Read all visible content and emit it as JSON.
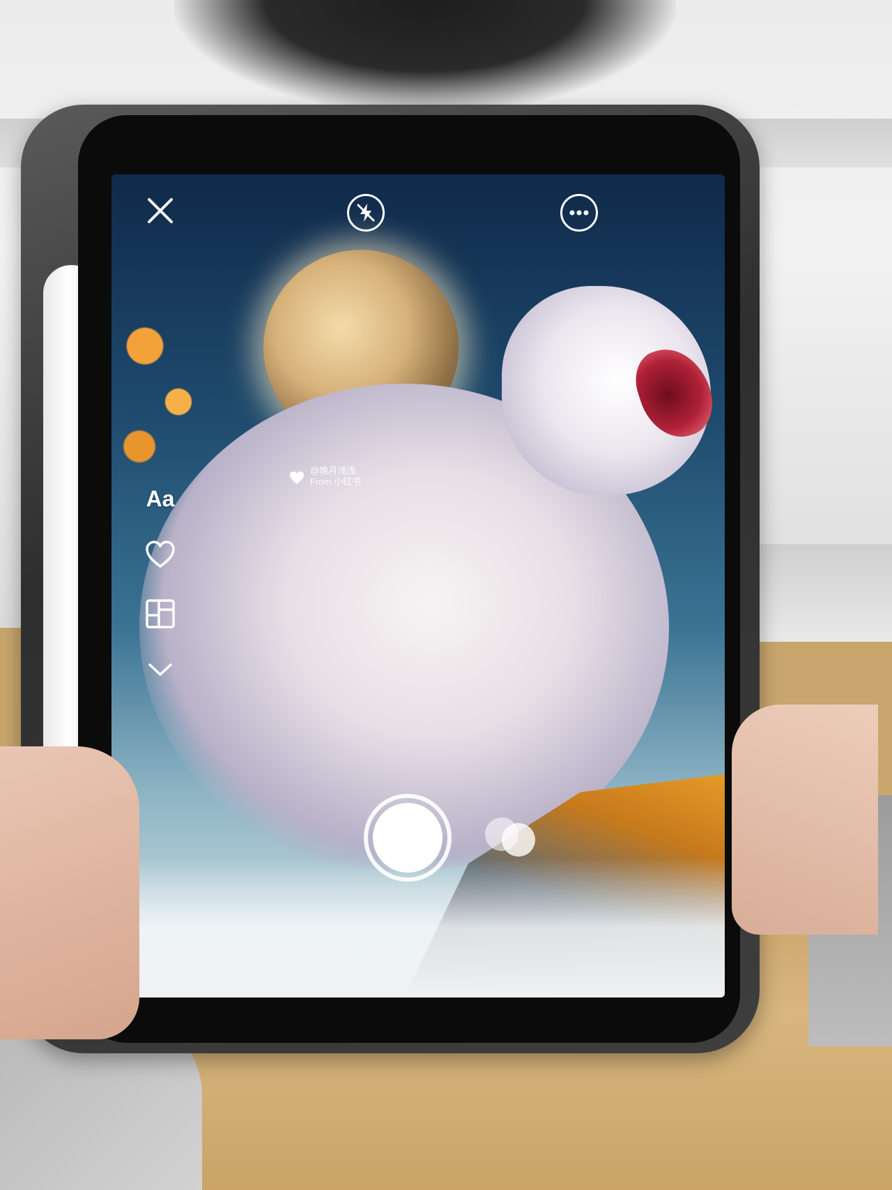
{
  "camera": {
    "side_tools": {
      "text_label": "Aa"
    },
    "watermark": {
      "line1": "@晚月浅浅",
      "line2": "From 小红书"
    }
  },
  "icons": {
    "close": "close-icon",
    "flash_off": "flash-off-icon",
    "more": "more-icon",
    "like": "heart-icon",
    "layout": "layout-grid-icon",
    "collapse": "chevron-down-icon",
    "shutter": "shutter-icon",
    "flip": "flip-camera-icon"
  },
  "colors": {
    "sky_top": "#10294a",
    "sky_mid": "#3b7393",
    "moon": "#d7b27a",
    "blossom": "#f3a23a",
    "ui_foreground": "#ffffff"
  }
}
